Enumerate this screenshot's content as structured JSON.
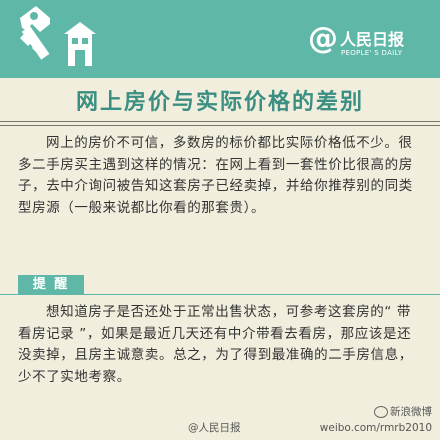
{
  "header": {
    "logo_at": "@",
    "logo_name": "人民日报",
    "logo_sub": "PEOPLE' S DAILY",
    "key_icon": "key-house-icon",
    "background_color": "#5fb8a7"
  },
  "title": "网上房价与实际价格的差别",
  "paragraph1": "网上的房价不可信，多数房的标价都比实际价格低不少。很多二手房买主遇到这样的情况：在网上看到一套性价比很高的房子，去中介询问被告知这套房子已经卖掉，并给你推荐别的同类型房源（一般来说都比你看的那套贵）。",
  "tip_label": "提 醒",
  "paragraph2": "想知道房子是否还处于正常出售状态，可参考这套房的“ 带看房记录 ”，如果是最近几天还有中介带看去看房，那应该是还没卖掉，且房主诚意卖。总之，为了得到最准确的二手房信息，少不了实地考察。",
  "footer": {
    "left": "@人民日报",
    "right_line1": "新浪微博",
    "right_line2": "weibo.com/rmrb2010"
  },
  "colors": {
    "accent": "#5fb8a7",
    "title": "#3a8f82",
    "background": "#f2eedd"
  }
}
